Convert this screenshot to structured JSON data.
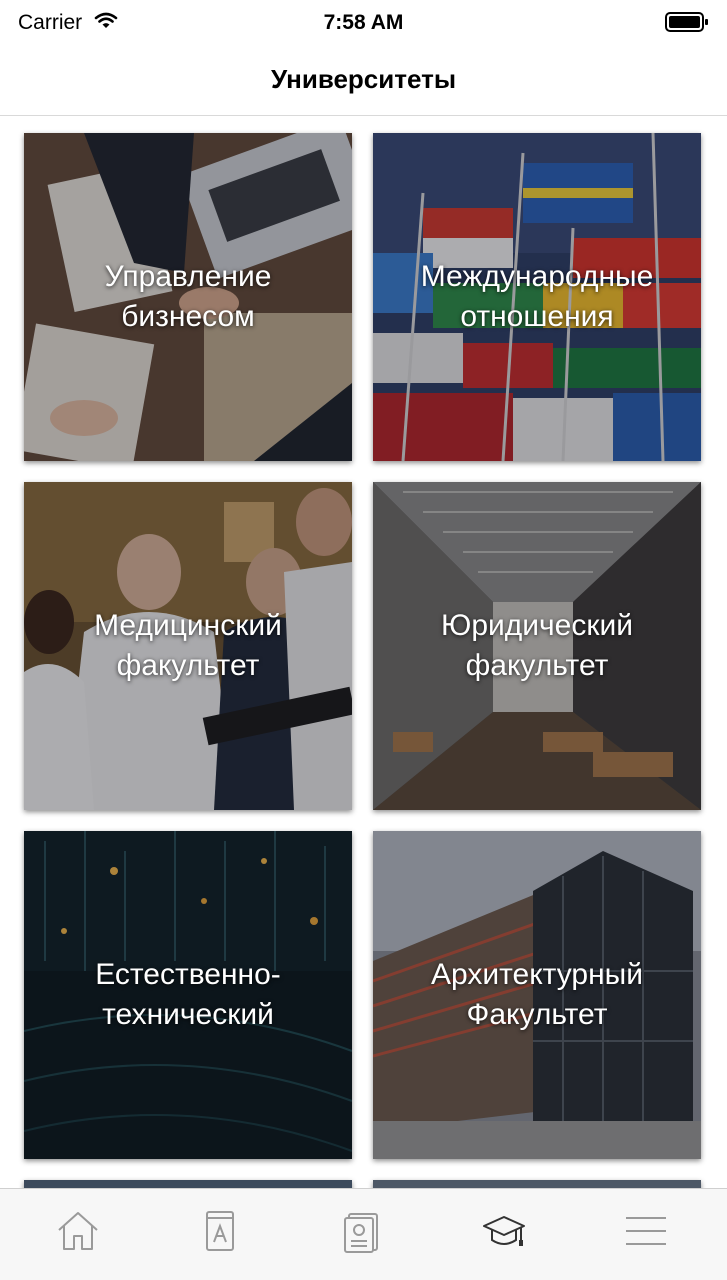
{
  "status_bar": {
    "carrier": "Carrier",
    "time": "7:58 AM"
  },
  "header": {
    "title": "Университеты"
  },
  "tiles": [
    {
      "line1": "Управление",
      "line2": "бизнесом",
      "image": "business-handshake"
    },
    {
      "line1": "Международные",
      "line2": "отношения",
      "image": "national-flags"
    },
    {
      "line1": "Медицинский",
      "line2": "факультет",
      "image": "doctors"
    },
    {
      "line1": "Юридический",
      "line2": "факультет",
      "image": "hallway"
    },
    {
      "line1": "Естественно-",
      "line2": "технический",
      "image": "math-formulas"
    },
    {
      "line1": "Архитектурный",
      "line2": "Факультет",
      "image": "glass-building"
    }
  ],
  "tab_bar": {
    "items": [
      {
        "icon": "home-icon"
      },
      {
        "icon": "book-icon"
      },
      {
        "icon": "id-card-icon"
      },
      {
        "icon": "graduation-cap-icon",
        "active": true
      },
      {
        "icon": "menu-icon"
      }
    ]
  },
  "colors": {
    "tab_icon": "#9a9a9a",
    "tab_icon_active": "#333333",
    "tile_text": "#ffffff"
  }
}
